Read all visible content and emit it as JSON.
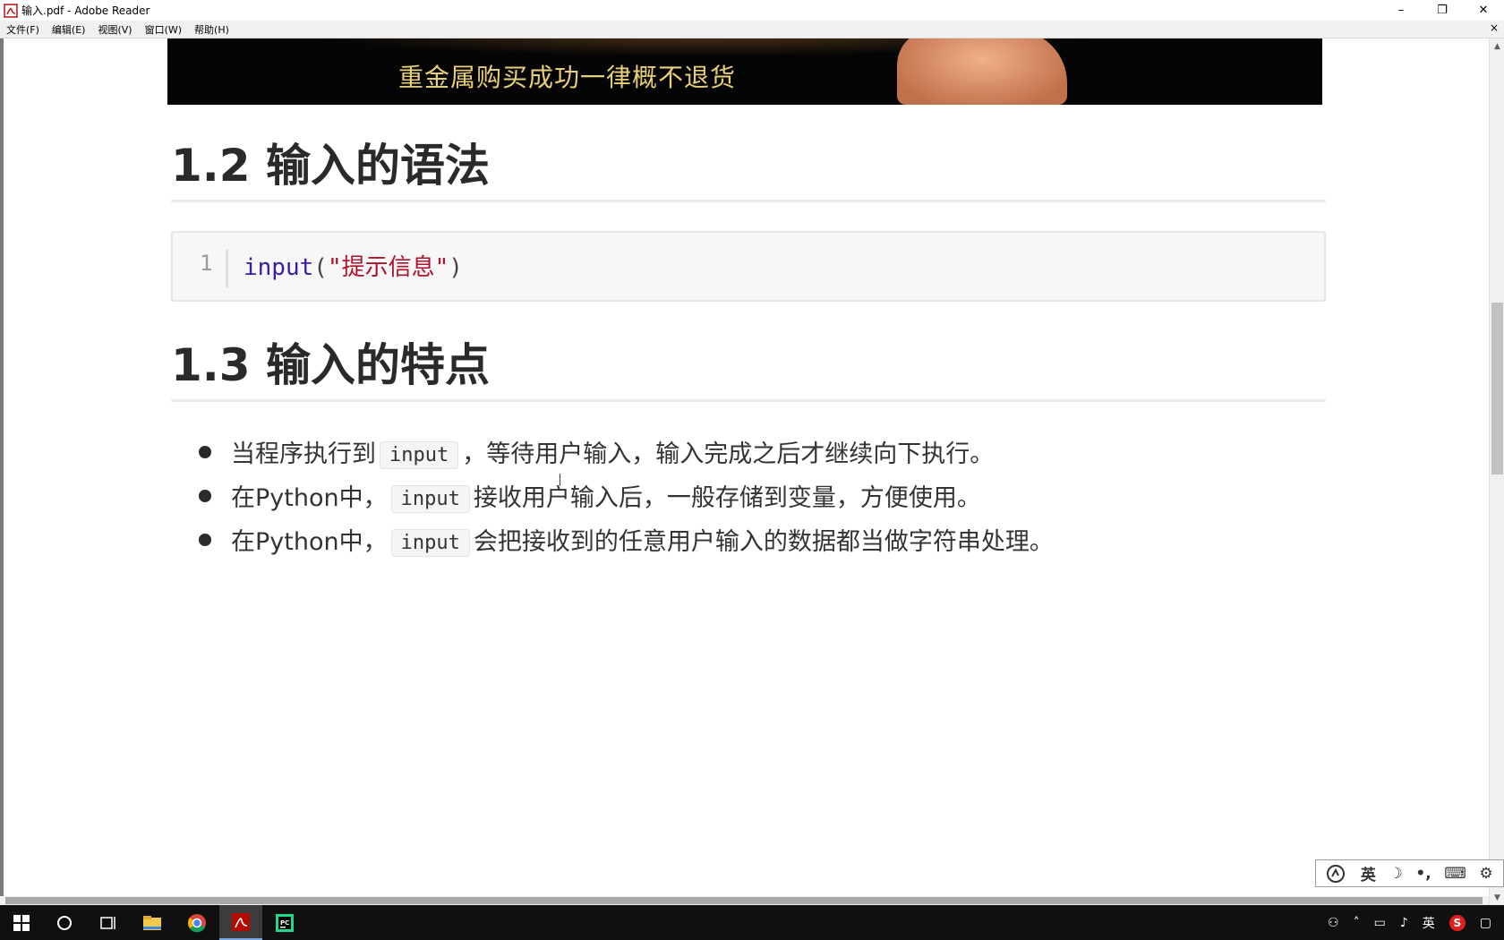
{
  "window": {
    "title": "输入.pdf - Adobe Reader",
    "minimize": "–",
    "restore": "❐",
    "close": "✕"
  },
  "menu": {
    "items": [
      {
        "label": "文件(F)"
      },
      {
        "label": "编辑(E)"
      },
      {
        "label": "视图(V)"
      },
      {
        "label": "窗口(W)"
      },
      {
        "label": "帮助(H)"
      }
    ],
    "doc_close": "×"
  },
  "document": {
    "banner_text": "重金属购买成功一律概不退货",
    "section_12": {
      "title": "1.2 输入的语法",
      "code": {
        "line_no": "1",
        "fn": "input",
        "open": "(",
        "str": "\"提示信息\"",
        "close": ")"
      }
    },
    "section_13": {
      "title": "1.3 输入的特点",
      "bullets": [
        {
          "pre": "当程序执行到",
          "code": "input",
          "post": "，等待用户输入，输入完成之后才继续向下执行。"
        },
        {
          "pre": "在Python中，",
          "code": "input",
          "post": "接收用户输入后，一般存储到变量，方便使用。"
        },
        {
          "pre": "在Python中，",
          "code": "input",
          "post": "会把接收到的任意用户输入的数据都当做字符串处理。"
        }
      ]
    }
  },
  "ime": {
    "lang": "英",
    "moon": "☽",
    "punct": "•,",
    "keyboard": "⌨",
    "gear": "⚙"
  },
  "taskbar": {
    "tray_lang": "英",
    "tray_s": "S"
  }
}
